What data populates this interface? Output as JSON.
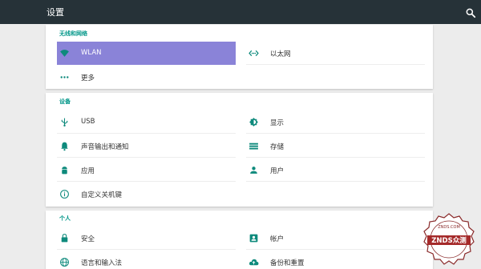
{
  "appbar": {
    "title": "设置",
    "search_icon": "search-icon"
  },
  "colors": {
    "appbar": "#263238",
    "accent": "#009688",
    "selected": "#8a83d8",
    "icon": "#0e8a7c"
  },
  "sections": [
    {
      "title": "无线和网络",
      "items": [
        {
          "label": "WLAN",
          "icon": "wifi-icon",
          "selected": true
        },
        {
          "label": "以太网",
          "icon": "ethernet-icon"
        },
        {
          "label": "更多",
          "icon": "more-icon"
        }
      ]
    },
    {
      "title": "设备",
      "items": [
        {
          "label": "USB",
          "icon": "usb-icon"
        },
        {
          "label": "显示",
          "icon": "display-icon"
        },
        {
          "label": "声音输出和通知",
          "icon": "bell-icon"
        },
        {
          "label": "存储",
          "icon": "storage-icon"
        },
        {
          "label": "应用",
          "icon": "android-icon"
        },
        {
          "label": "用户",
          "icon": "user-icon"
        },
        {
          "label": "自定义关机键",
          "icon": "info-icon"
        }
      ]
    },
    {
      "title": "个人",
      "items": [
        {
          "label": "安全",
          "icon": "lock-icon"
        },
        {
          "label": "帐户",
          "icon": "account-icon"
        },
        {
          "label": "语言和输入法",
          "icon": "globe-icon"
        },
        {
          "label": "备份和重置",
          "icon": "cloud-upload-icon"
        }
      ]
    }
  ],
  "watermark": {
    "text": "ZNDS众测",
    "small": "ZNDS.COM"
  }
}
